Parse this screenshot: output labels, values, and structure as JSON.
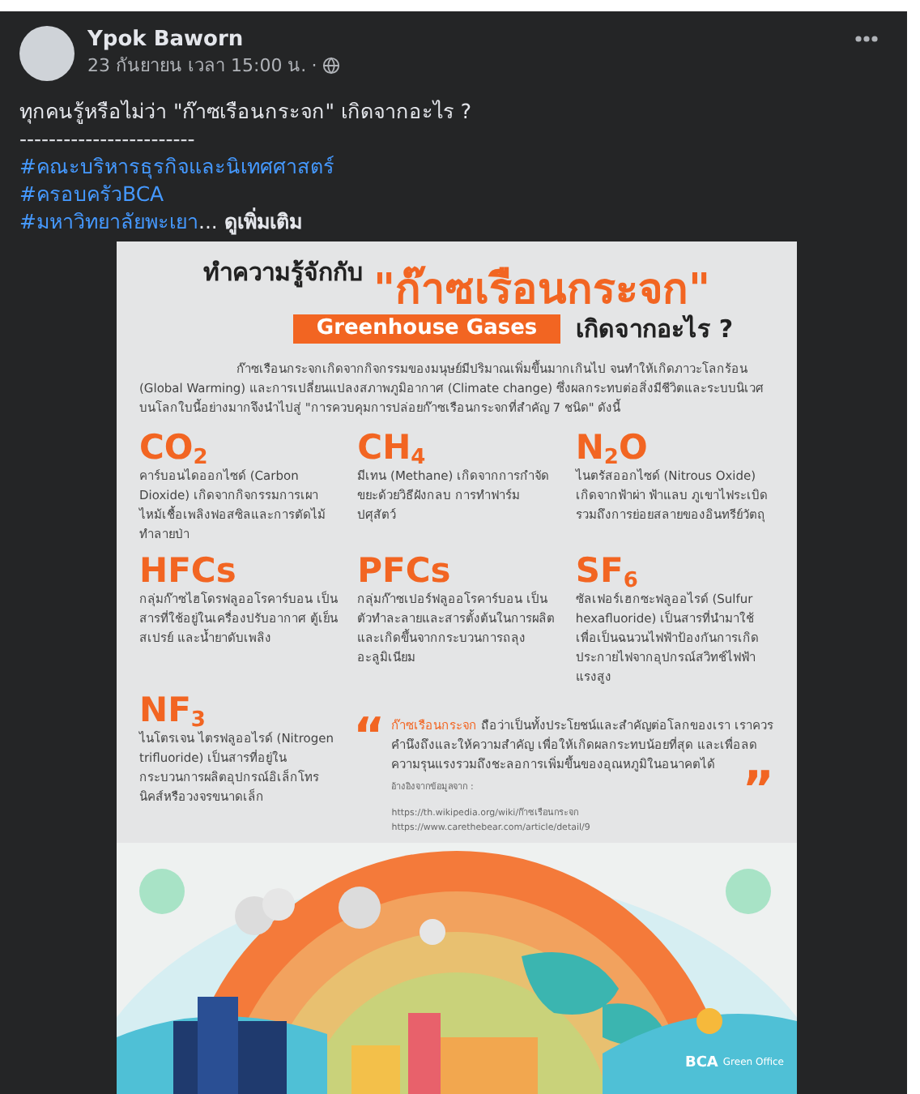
{
  "post": {
    "author": "Ypok Baworn",
    "time": "23 กันยายน เวลา 15:00 น.",
    "separator": "·",
    "lines": [
      "ทุกคนรู้หรือไม่ว่า \"ก๊าซเรือนกระจก\" เกิดจากอะไร ?",
      "------------------------"
    ],
    "hashtags": [
      "#คณะบริหารธุรกิจและนิเทศศาสตร์",
      "#ครอบครัวBCA",
      "#มหาวิทยาลัยพะเยา"
    ],
    "ellipsis": "...",
    "see_more": "ดูเพิ่มเติม"
  },
  "infographic": {
    "title_prefix": "ทำความรู้จักกับ",
    "title_main": "\"ก๊าซเรือนกระจก\"",
    "subtitle": "Greenhouse Gases",
    "title_suffix": "เกิดจากอะไร ?",
    "intro": "ก๊าซเรือนกระจกเกิดจากกิจกรรมของมนุษย์มีปริมาณเพิ่มขึ้นมากเกินไป จนทำให้เกิดภาวะโลกร้อน (Global Warming) และการเปลี่ยนแปลงสภาพภูมิอากาศ (Climate change) ซึ่งผลกระทบต่อสิ่งมีชีวิตและระบบนิเวศบนโลกใบนี้อย่างมากจึงนำไปสู่ \"การควบคุมการปล่อยก๊าซเรือนกระจกที่สำคัญ 7 ชนิด\" ดังนี้",
    "gases": [
      {
        "formula": "CO$_{2}$",
        "description": "คาร์บอนไดออกไซด์ (Carbon Dioxide) เกิดจากกิจกรรมการเผาไหม้เชื้อเพลิงฟอสซิลและการตัดไม้ทำลายป่า"
      },
      {
        "formula": "CH$_{4}$",
        "description": "มีเทน (Methane) เกิดจากการกำจัดขยะด้วยวิธีฝังกลบ การทำฟาร์มปศุสัตว์"
      },
      {
        "formula": "N$_{2}$O",
        "description": "ไนตรัสออกไซด์ (Nitrous Oxide) เกิดจากฟ้าผ่า ฟ้าแลบ ภูเขาไฟระเบิด รวมถึงการย่อยสลายของอินทรีย์วัตถุ"
      },
      {
        "formula": "HFCs",
        "description": "กลุ่มก๊าซไฮโดรฟลูออโรคาร์บอน เป็นสารที่ใช้อยู่ในเครื่องปรับอากาศ ตู้เย็น สเปรย์ และน้ำยาดับเพลิง"
      },
      {
        "formula": "PFCs",
        "description": "กลุ่มก๊าซเปอร์ฟลูออโรคาร์บอน เป็นตัวทำละลายและสารตั้งต้นในการผลิต และเกิดขึ้นจากกระบวนการถลุงอะลูมิเนียม"
      },
      {
        "formula": "SF$_{6}$",
        "description": "ซัลเฟอร์เฮกซะฟลูออไรด์ (Sulfur hexafluoride) เป็นสารที่นำมาใช้เพื่อเป็นฉนวนไฟฟ้าป้องกันการเกิดประกายไฟจากอุปกรณ์สวิทช์ไฟฟ้าแรงสูง"
      },
      {
        "formula": "NF$_{3}$",
        "description": "ไนโตรเจน ไตรฟลูออไรด์ (Nitrogen trifluoride) เป็นสารที่อยู่ในกระบวนการผลิตอุปกรณ์อิเล็กโทรนิคส์หรือวงจรขนาดเล็ก"
      }
    ],
    "quote": {
      "open_mark": "“",
      "highlight": "ก๊าซเรือนกระจก",
      "text": " ถือว่าเป็นทั้งประโยชน์และสำคัญต่อโลกของเรา เราควรคำนึงถึงและให้ความสำคัญ เพื่อให้เกิดผลกระทบน้อยที่สุด และเพื่อลดความรุนแรงรวมถึงชะลอการเพิ่มขึ้นของอุณหภูมิในอนาคตได้",
      "close_mark": "”"
    },
    "sources_label": "อ้างอิงจากข้อมูลจาก :",
    "sources": [
      "https://th.wikipedia.org/wiki/ก๊าซเรือนกระจก",
      "https://www.carethebear.com/article/detail/9"
    ],
    "logo": {
      "name": "BCA",
      "subtitle": "Green Office"
    }
  }
}
